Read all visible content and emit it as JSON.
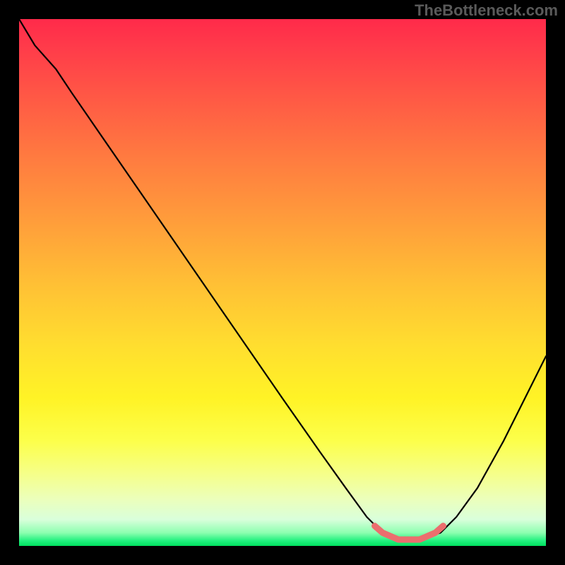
{
  "watermark": "TheBottleneck.com",
  "chart_data": {
    "type": "line",
    "title": "",
    "xlabel": "",
    "ylabel": "",
    "xlim": [
      0,
      100
    ],
    "ylim": [
      0,
      100
    ],
    "gradient_stops": [
      {
        "pos": 0,
        "color": "#ff2a4a"
      },
      {
        "pos": 5,
        "color": "#ff3a4a"
      },
      {
        "pos": 15,
        "color": "#ff5945"
      },
      {
        "pos": 26,
        "color": "#ff7a40"
      },
      {
        "pos": 38,
        "color": "#ff9c3b"
      },
      {
        "pos": 50,
        "color": "#ffbf35"
      },
      {
        "pos": 62,
        "color": "#ffde2f"
      },
      {
        "pos": 72,
        "color": "#fff326"
      },
      {
        "pos": 80,
        "color": "#fcff4a"
      },
      {
        "pos": 86,
        "color": "#f6ff86"
      },
      {
        "pos": 91,
        "color": "#ecffba"
      },
      {
        "pos": 95,
        "color": "#d9ffdb"
      },
      {
        "pos": 97.5,
        "color": "#8dffb0"
      },
      {
        "pos": 99,
        "color": "#22f17f"
      },
      {
        "pos": 100,
        "color": "#00e05f"
      }
    ],
    "series": [
      {
        "name": "bottleneck-curve",
        "color": "#000000",
        "points": [
          {
            "x": 0,
            "y": 100
          },
          {
            "x": 3,
            "y": 95
          },
          {
            "x": 7,
            "y": 90.5
          },
          {
            "x": 10,
            "y": 86
          },
          {
            "x": 20,
            "y": 71.5
          },
          {
            "x": 30,
            "y": 57
          },
          {
            "x": 40,
            "y": 42.5
          },
          {
            "x": 50,
            "y": 28
          },
          {
            "x": 57,
            "y": 18
          },
          {
            "x": 62,
            "y": 11
          },
          {
            "x": 66,
            "y": 5.5
          },
          {
            "x": 69,
            "y": 2.5
          },
          {
            "x": 72,
            "y": 1.2
          },
          {
            "x": 76,
            "y": 1.2
          },
          {
            "x": 80,
            "y": 2.5
          },
          {
            "x": 83,
            "y": 5.5
          },
          {
            "x": 87,
            "y": 11
          },
          {
            "x": 92,
            "y": 20
          },
          {
            "x": 96,
            "y": 28
          },
          {
            "x": 100,
            "y": 36
          }
        ]
      }
    ],
    "highlight_band": {
      "name": "optimal-band",
      "color": "#eb6e6e",
      "points": [
        {
          "x": 67.5,
          "y": 3.8
        },
        {
          "x": 69,
          "y": 2.5
        },
        {
          "x": 72,
          "y": 1.2
        },
        {
          "x": 76,
          "y": 1.2
        },
        {
          "x": 79,
          "y": 2.5
        },
        {
          "x": 80.5,
          "y": 3.8
        }
      ]
    }
  }
}
